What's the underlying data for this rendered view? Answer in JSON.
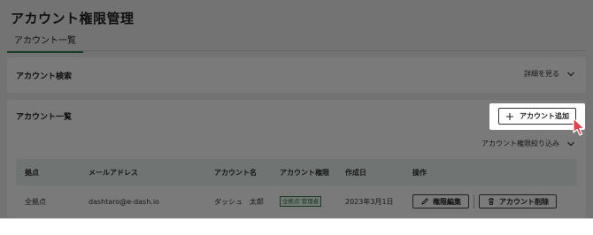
{
  "page": {
    "title": "アカウント権限管理"
  },
  "tabs": [
    {
      "label": "アカウント一覧",
      "active": true
    }
  ],
  "search_section": {
    "title": "アカウント検索",
    "details_label": "詳細を見る"
  },
  "list_section": {
    "title": "アカウント一覧",
    "add_button_label": "アカウント追加",
    "filter_label": "アカウント権限絞り込み"
  },
  "table": {
    "headers": [
      "拠点",
      "メールアドレス",
      "アカウント名",
      "アカウント権限",
      "作成日",
      "操作"
    ],
    "rows": [
      {
        "location": "全拠点",
        "email": "dashtaro@e-dash.io",
        "name": "ダッシュ　太郎",
        "permission_badge": "全拠点 管理者",
        "created": "2023年3月1日",
        "edit_label": "権限編集",
        "delete_label": "アカウント削除"
      }
    ]
  },
  "colors": {
    "accent": "#2e7d4f",
    "header_bg": "#eaf3ee",
    "cursor": "#e0414f"
  },
  "icons": [
    "chevron-down-icon",
    "plus-icon",
    "pencil-icon",
    "trash-icon",
    "mouse-pointer-icon"
  ]
}
